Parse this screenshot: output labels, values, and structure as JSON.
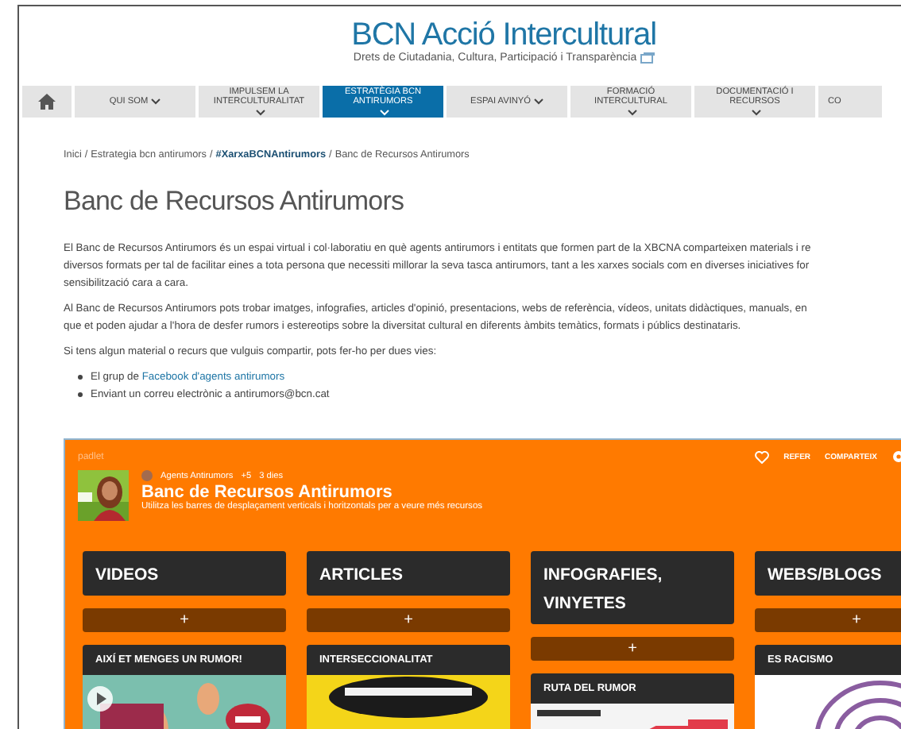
{
  "site": {
    "title": "BCN Acció Intercultural",
    "subtitle": "Drets de Ciutadania, Cultura, Participació i Transparència"
  },
  "nav": [
    {
      "kind": "home",
      "selected": false
    },
    {
      "kind": "menu",
      "label": "QUI SOM",
      "selected": false
    },
    {
      "kind": "menu",
      "label": "IMPULSEM LA INTERCULTURALITAT",
      "selected": false
    },
    {
      "kind": "menu",
      "label": "ESTRATÈGIA BCN ANTIRUMORS",
      "selected": true
    },
    {
      "kind": "menu",
      "label": "ESPAI AVINYÓ",
      "selected": false
    },
    {
      "kind": "menu",
      "label": "FORMACIÓ INTERCULTURAL",
      "selected": false
    },
    {
      "kind": "menu",
      "label": "DOCUMENTACIÓ I RECURSOS",
      "selected": false
    },
    {
      "kind": "cut",
      "label": "CO",
      "selected": false
    }
  ],
  "breadcrumb": [
    {
      "kind": "link",
      "label": "Inici",
      "bold": false
    },
    {
      "kind": "separator",
      "label": "/"
    },
    {
      "kind": "link",
      "label": "Estrategia bcn antirumors",
      "bold": false
    },
    {
      "kind": "separator",
      "label": "/"
    },
    {
      "kind": "link",
      "label": "#XarxaBCNAntirumors",
      "bold": true
    },
    {
      "kind": "separator",
      "label": "/"
    },
    {
      "kind": "current",
      "label": "Banc de Recursos Antirumors"
    }
  ],
  "heading": "Banc de Recursos Antirumors",
  "paragraphs": [
    [
      "El Banc de Recursos Antirumors és un espai virtual i col·laboratiu en què agents antirumors i entitats que formen part de la XBCNA comparteixen materials i re",
      "diversos formats per tal de facilitar eines a tota persona que necessiti millorar la seva tasca antirumors, tant a les xarxes socials com en diverses iniciatives for",
      "sensibilització cara a cara."
    ],
    [
      "Al Banc de Recursos Antirumors pots trobar imatges, infografies, articles d'opinió, presentacions, webs de referència, vídeos, unitats didàctiques, manuals, en",
      "que et poden ajudar a l'hora de desfer rumors i estereotips sobre la diversitat cultural en diferents àmbits temàtics, formats i públics destinataris."
    ],
    [
      "Si tens algun material o recurs que vulguis compartir, pots fer-ho per dues vies:"
    ]
  ],
  "bullets": [
    {
      "text": "El grup de ",
      "link": "Facebook d'agents antirumors"
    },
    {
      "text": "Enviant un correu electrònic a antirumors@bcn.cat"
    }
  ],
  "padlet": {
    "brand": "padlet",
    "actions": [
      "REFER",
      "COMPARTEIX"
    ],
    "author": "Agents Antirumors",
    "contributors": "+5",
    "age": "3 dies",
    "title": "Banc de Recursos Antirumors",
    "subtitle": "Utilitza les barres de desplaçament verticals i horitzontals per a veure més recursos",
    "columns": [
      {
        "title": "VIDEOS",
        "add": "+",
        "card": {
          "title": "AIXÍ ET MENGES UN RUMOR!",
          "kind": "video"
        }
      },
      {
        "title": "ARTICLES",
        "add": "+",
        "card": {
          "title": "INTERSECCIONALITAT",
          "kind": "poster"
        }
      },
      {
        "title": "INFOGRAFIES, VINYETES",
        "add": "+",
        "card": {
          "title": "RUTA DEL RUMOR",
          "kind": "map"
        }
      },
      {
        "title": "WEBS/BLOGS",
        "add": "+",
        "card": {
          "title": "ES RACISMO",
          "kind": "print"
        }
      }
    ]
  }
}
